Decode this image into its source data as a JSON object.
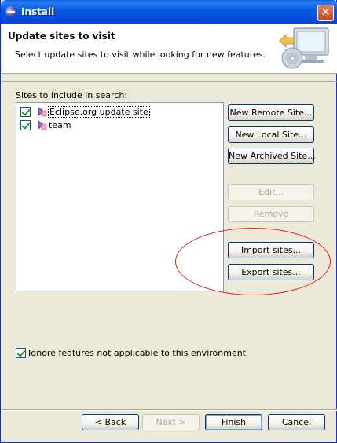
{
  "window": {
    "title": "Install"
  },
  "banner": {
    "title": "Update sites to visit",
    "description": "Select update sites to visit while looking for new features."
  },
  "sites": {
    "label": "Sites to include in search:",
    "items": [
      {
        "label": "Eclipse.org update site",
        "checked": true,
        "selected": true
      },
      {
        "label": "team",
        "checked": true,
        "selected": false
      }
    ]
  },
  "side_buttons": {
    "new_remote": "New Remote Site...",
    "new_local": "New Local Site...",
    "new_archived": "New Archived Site...",
    "edit": "Edit...",
    "remove": "Remove",
    "import": "Import sites...",
    "export": "Export sites..."
  },
  "ignore_option": {
    "label": "Ignore features not applicable to this environment",
    "checked": true
  },
  "footer": {
    "back": "< Back",
    "next": "Next >",
    "finish": "Finish",
    "cancel": "Cancel"
  },
  "colors": {
    "titlebar": "#0757e3",
    "annotation": "#e02020",
    "dialog_bg": "#ece9d8"
  }
}
